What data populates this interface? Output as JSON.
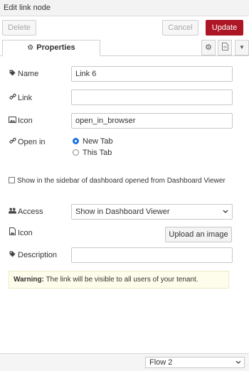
{
  "header": {
    "title": "Edit link node"
  },
  "toolbar": {
    "delete_label": "Delete",
    "cancel_label": "Cancel",
    "update_label": "Update"
  },
  "tabs": {
    "properties_label": "Properties"
  },
  "form": {
    "name_label": "Name",
    "name_value": "Link 6",
    "link_label": "Link",
    "link_value": "",
    "icon_label": "Icon",
    "icon_value": "open_in_browser",
    "open_in_label": "Open in",
    "open_in_options": [
      "New Tab",
      "This Tab"
    ],
    "open_in_selected": "New Tab",
    "sidebar_checkbox_label": "Show in the sidebar of dashboard opened from Dashboard Viewer",
    "sidebar_checkbox_checked": false,
    "access_label": "Access",
    "access_value": "Show in Dashboard Viewer",
    "image_icon_label": "Icon",
    "upload_label": "Upload an image",
    "description_label": "Description",
    "description_value": ""
  },
  "warning": {
    "strong": "Warning:",
    "text": " The link will be visible to all users of your tenant."
  },
  "footer": {
    "flow_value": "Flow 2"
  },
  "colors": {
    "update_bg": "#ad1625",
    "radio_accent": "#1a73e8",
    "warning_bg": "#fefdec"
  },
  "icons": [
    "gear-icon",
    "document-icon",
    "caret-down-icon",
    "tag-icon",
    "link-icon",
    "image-icon",
    "users-icon"
  ]
}
